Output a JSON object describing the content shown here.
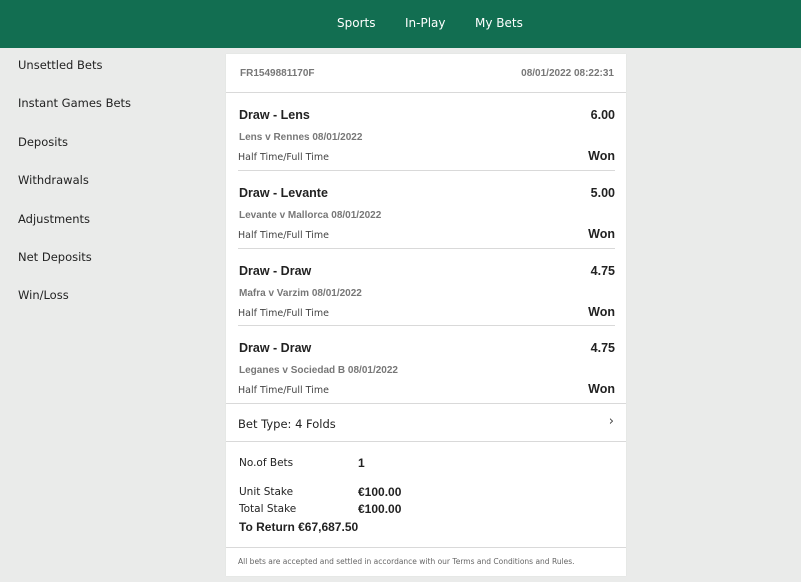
{
  "nav": {
    "items": [
      "Sports",
      "In-Play",
      "My Bets"
    ]
  },
  "sidebar": {
    "items": [
      "Unsettled Bets",
      "Instant Games Bets",
      "Deposits",
      "Withdrawals",
      "Adjustments",
      "Net Deposits",
      "Win/Loss"
    ]
  },
  "bet": {
    "reference": "FR1549881170F",
    "datetime": "08/01/2022 08:22:31",
    "selections": [
      {
        "name": "Draw - Lens",
        "odds": "6.00",
        "event": "Lens v Rennes 08/01/2022",
        "market": "Half Time/Full Time",
        "result": "Won"
      },
      {
        "name": "Draw - Levante",
        "odds": "5.00",
        "event": "Levante v Mallorca 08/01/2022",
        "market": "Half Time/Full Time",
        "result": "Won"
      },
      {
        "name": "Draw - Draw",
        "odds": "4.75",
        "event": "Mafra v Varzim 08/01/2022",
        "market": "Half Time/Full Time",
        "result": "Won"
      },
      {
        "name": "Draw - Draw",
        "odds": "4.75",
        "event": "Leganes v Sociedad B 08/01/2022",
        "market": "Half Time/Full Time",
        "result": "Won"
      }
    ],
    "bet_type": "Bet Type: 4 Folds",
    "chevron": "›",
    "summary": {
      "no_of_bets_label": "No.of Bets",
      "no_of_bets": "1",
      "unit_stake_label": "Unit Stake",
      "unit_stake": "€100.00",
      "total_stake_label": "Total Stake",
      "total_stake": "€100.00",
      "to_return": "To Return €67,687.50"
    },
    "footer": "All bets are accepted and settled in accordance with our Terms and Conditions and Rules."
  },
  "colors": {
    "header": "#126e51",
    "background": "#eaebea"
  }
}
